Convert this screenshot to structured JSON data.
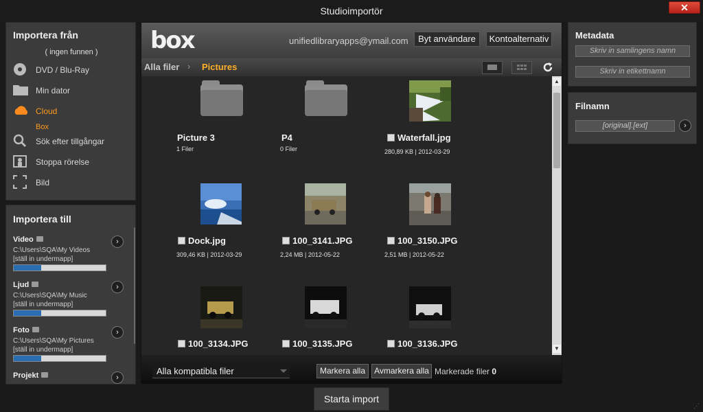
{
  "window": {
    "title": "Studioimportör",
    "close": "✕"
  },
  "source": {
    "heading": "Importera från",
    "none_found": "( ingen funnen )",
    "items": [
      {
        "label": "DVD / Blu-Ray",
        "icon": "disc-icon"
      },
      {
        "label": "Min dator",
        "icon": "folder-icon"
      },
      {
        "label": "Cloud",
        "icon": "cloud-icon",
        "active": true
      },
      {
        "label": "Sök efter tillgångar",
        "icon": "search-icon"
      },
      {
        "label": "Stoppa rörelse",
        "icon": "stop-motion-icon"
      },
      {
        "label": "Bild",
        "icon": "snapshot-icon"
      }
    ],
    "cloud_sub": "Box"
  },
  "destination": {
    "heading": "Importera till",
    "groups": [
      {
        "title": "Video",
        "path": "C:\\Users\\SQA\\My Videos",
        "sub": "[ställ in undermapp]",
        "fill": 0.3
      },
      {
        "title": "Ljud",
        "path": "C:\\Users\\SQA\\My Music",
        "sub": "[ställ in undermapp]",
        "fill": 0.3
      },
      {
        "title": "Foto",
        "path": "C:\\Users\\SQA\\My Pictures",
        "sub": "[ställ in undermapp]",
        "fill": 0.3
      },
      {
        "title": "Projekt",
        "path": "",
        "sub": "",
        "fill": 0
      }
    ]
  },
  "box": {
    "logo": "box",
    "email": "unifiedlibraryapps@ymail.com",
    "switch_user": "Byt användare",
    "account_options": "Kontoalternativ",
    "crumb_root": "Alla filer",
    "crumb_sep": "›",
    "crumb_current": "Pictures"
  },
  "files": [
    {
      "name": "Picture 3",
      "meta": "1 Filer",
      "type": "folder"
    },
    {
      "name": "P4",
      "meta": "0 Filer",
      "type": "folder"
    },
    {
      "name": "Waterfall.jpg",
      "meta": "280,89 KB | 2012-03-29",
      "type": "image",
      "thumb": "waterfall"
    },
    {
      "name": "Dock.jpg",
      "meta": "309,46 KB | 2012-03-29",
      "type": "image",
      "thumb": "dock"
    },
    {
      "name": "100_3141.JPG",
      "meta": "2,24 MB | 2012-05-22",
      "type": "image",
      "thumb": "jeep-day"
    },
    {
      "name": "100_3150.JPG",
      "meta": "2,51 MB | 2012-05-22",
      "type": "image",
      "thumb": "people"
    },
    {
      "name": "100_3134.JPG",
      "meta": "",
      "type": "image",
      "thumb": "jeep-night-yellow"
    },
    {
      "name": "100_3135.JPG",
      "meta": "",
      "type": "image",
      "thumb": "jeep-night"
    },
    {
      "name": "100_3136.JPG",
      "meta": "",
      "type": "image",
      "thumb": "jeep-night2"
    }
  ],
  "footer": {
    "filter": "Alla kompatibla filer",
    "select_all": "Markera alla",
    "deselect_all": "Avmarkera alla",
    "marked_label": "Markerade filer",
    "marked_count": "0"
  },
  "metadata": {
    "heading": "Metadata",
    "collection_placeholder": "Skriv in samlingens namn",
    "tag_placeholder": "Skriv in etikettnamn"
  },
  "filename": {
    "heading": "Filnamn",
    "pattern": "[original].[ext]"
  },
  "start_import": "Starta import"
}
